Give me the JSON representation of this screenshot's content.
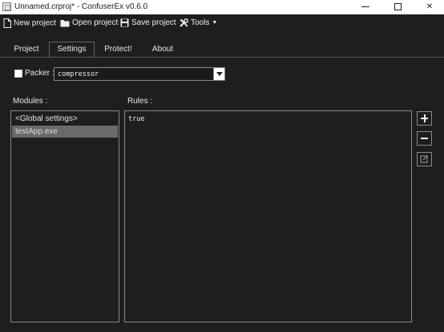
{
  "window": {
    "title": "Unnamed.crproj* - ConfuserEx v0.6.0"
  },
  "toolbar": {
    "new_project": "New project",
    "open_project": "Open project",
    "save_project": "Save project",
    "tools": "Tools"
  },
  "tabs": [
    {
      "label": "Project",
      "selected": false
    },
    {
      "label": "Settings",
      "selected": true
    },
    {
      "label": "Protect!",
      "selected": false
    },
    {
      "label": "About",
      "selected": false
    }
  ],
  "packer": {
    "label": "Packer :",
    "checked": false,
    "selected_value": "compressor"
  },
  "modules": {
    "label": "Modules :",
    "items": [
      {
        "label": "<Global settings>",
        "selected": false
      },
      {
        "label": "testApp.exe",
        "selected": true
      }
    ]
  },
  "rules": {
    "label": "Rules :",
    "items": [
      {
        "label": "true"
      }
    ]
  },
  "icons": {
    "new_project": "new-document-icon",
    "open_project": "folder-icon",
    "save_project": "floppy-disk-icon",
    "tools": "wrench-screwdriver-icon",
    "add": "plus-icon",
    "remove": "minus-icon",
    "edit": "edit-pencil-icon"
  },
  "colors": {
    "background": "#1e1e1e",
    "text": "#e8e8e8",
    "selected_item": "#6a6a6a",
    "border": "#8a8a8a",
    "titlebar": "#ffffff"
  }
}
